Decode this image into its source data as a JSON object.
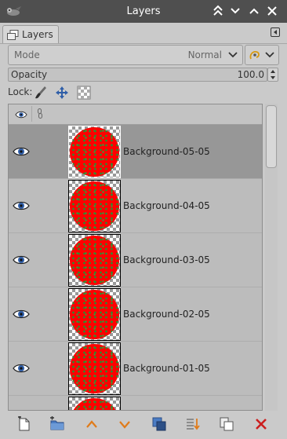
{
  "window": {
    "title": "Layers"
  },
  "window_buttons": [
    "shade-up-icon",
    "chevron-down-icon",
    "chevron-up-icon",
    "close-icon"
  ],
  "tab": {
    "label": "Layers"
  },
  "mode": {
    "label": "Mode",
    "value": "Normal"
  },
  "opacity": {
    "label": "Opacity",
    "value": "100.0"
  },
  "lock": {
    "label": "Lock:"
  },
  "layers": [
    {
      "name": "Background-05-05",
      "visible": true,
      "selected": true
    },
    {
      "name": "Background-04-05",
      "visible": true,
      "selected": false
    },
    {
      "name": "Background-03-05",
      "visible": true,
      "selected": false
    },
    {
      "name": "Background-02-05",
      "visible": true,
      "selected": false
    },
    {
      "name": "Background-01-05",
      "visible": true,
      "selected": false
    },
    {
      "name": "",
      "visible": true,
      "selected": false
    }
  ],
  "colors": {
    "titlebar": "#4f4f4f",
    "panel": "#cacaca",
    "selected_row": "#979797",
    "layer_fill": "#ff0000",
    "eye_blue": "#2f5ea8",
    "arrow_orange": "#e07b1a",
    "delete_red": "#cc1f1f"
  },
  "bottom_buttons": [
    "new-layer-icon",
    "new-layer-group-icon",
    "raise-layer-icon",
    "lower-layer-icon",
    "duplicate-layer-icon",
    "merge-down-icon",
    "anchor-layer-icon",
    "delete-layer-icon"
  ]
}
